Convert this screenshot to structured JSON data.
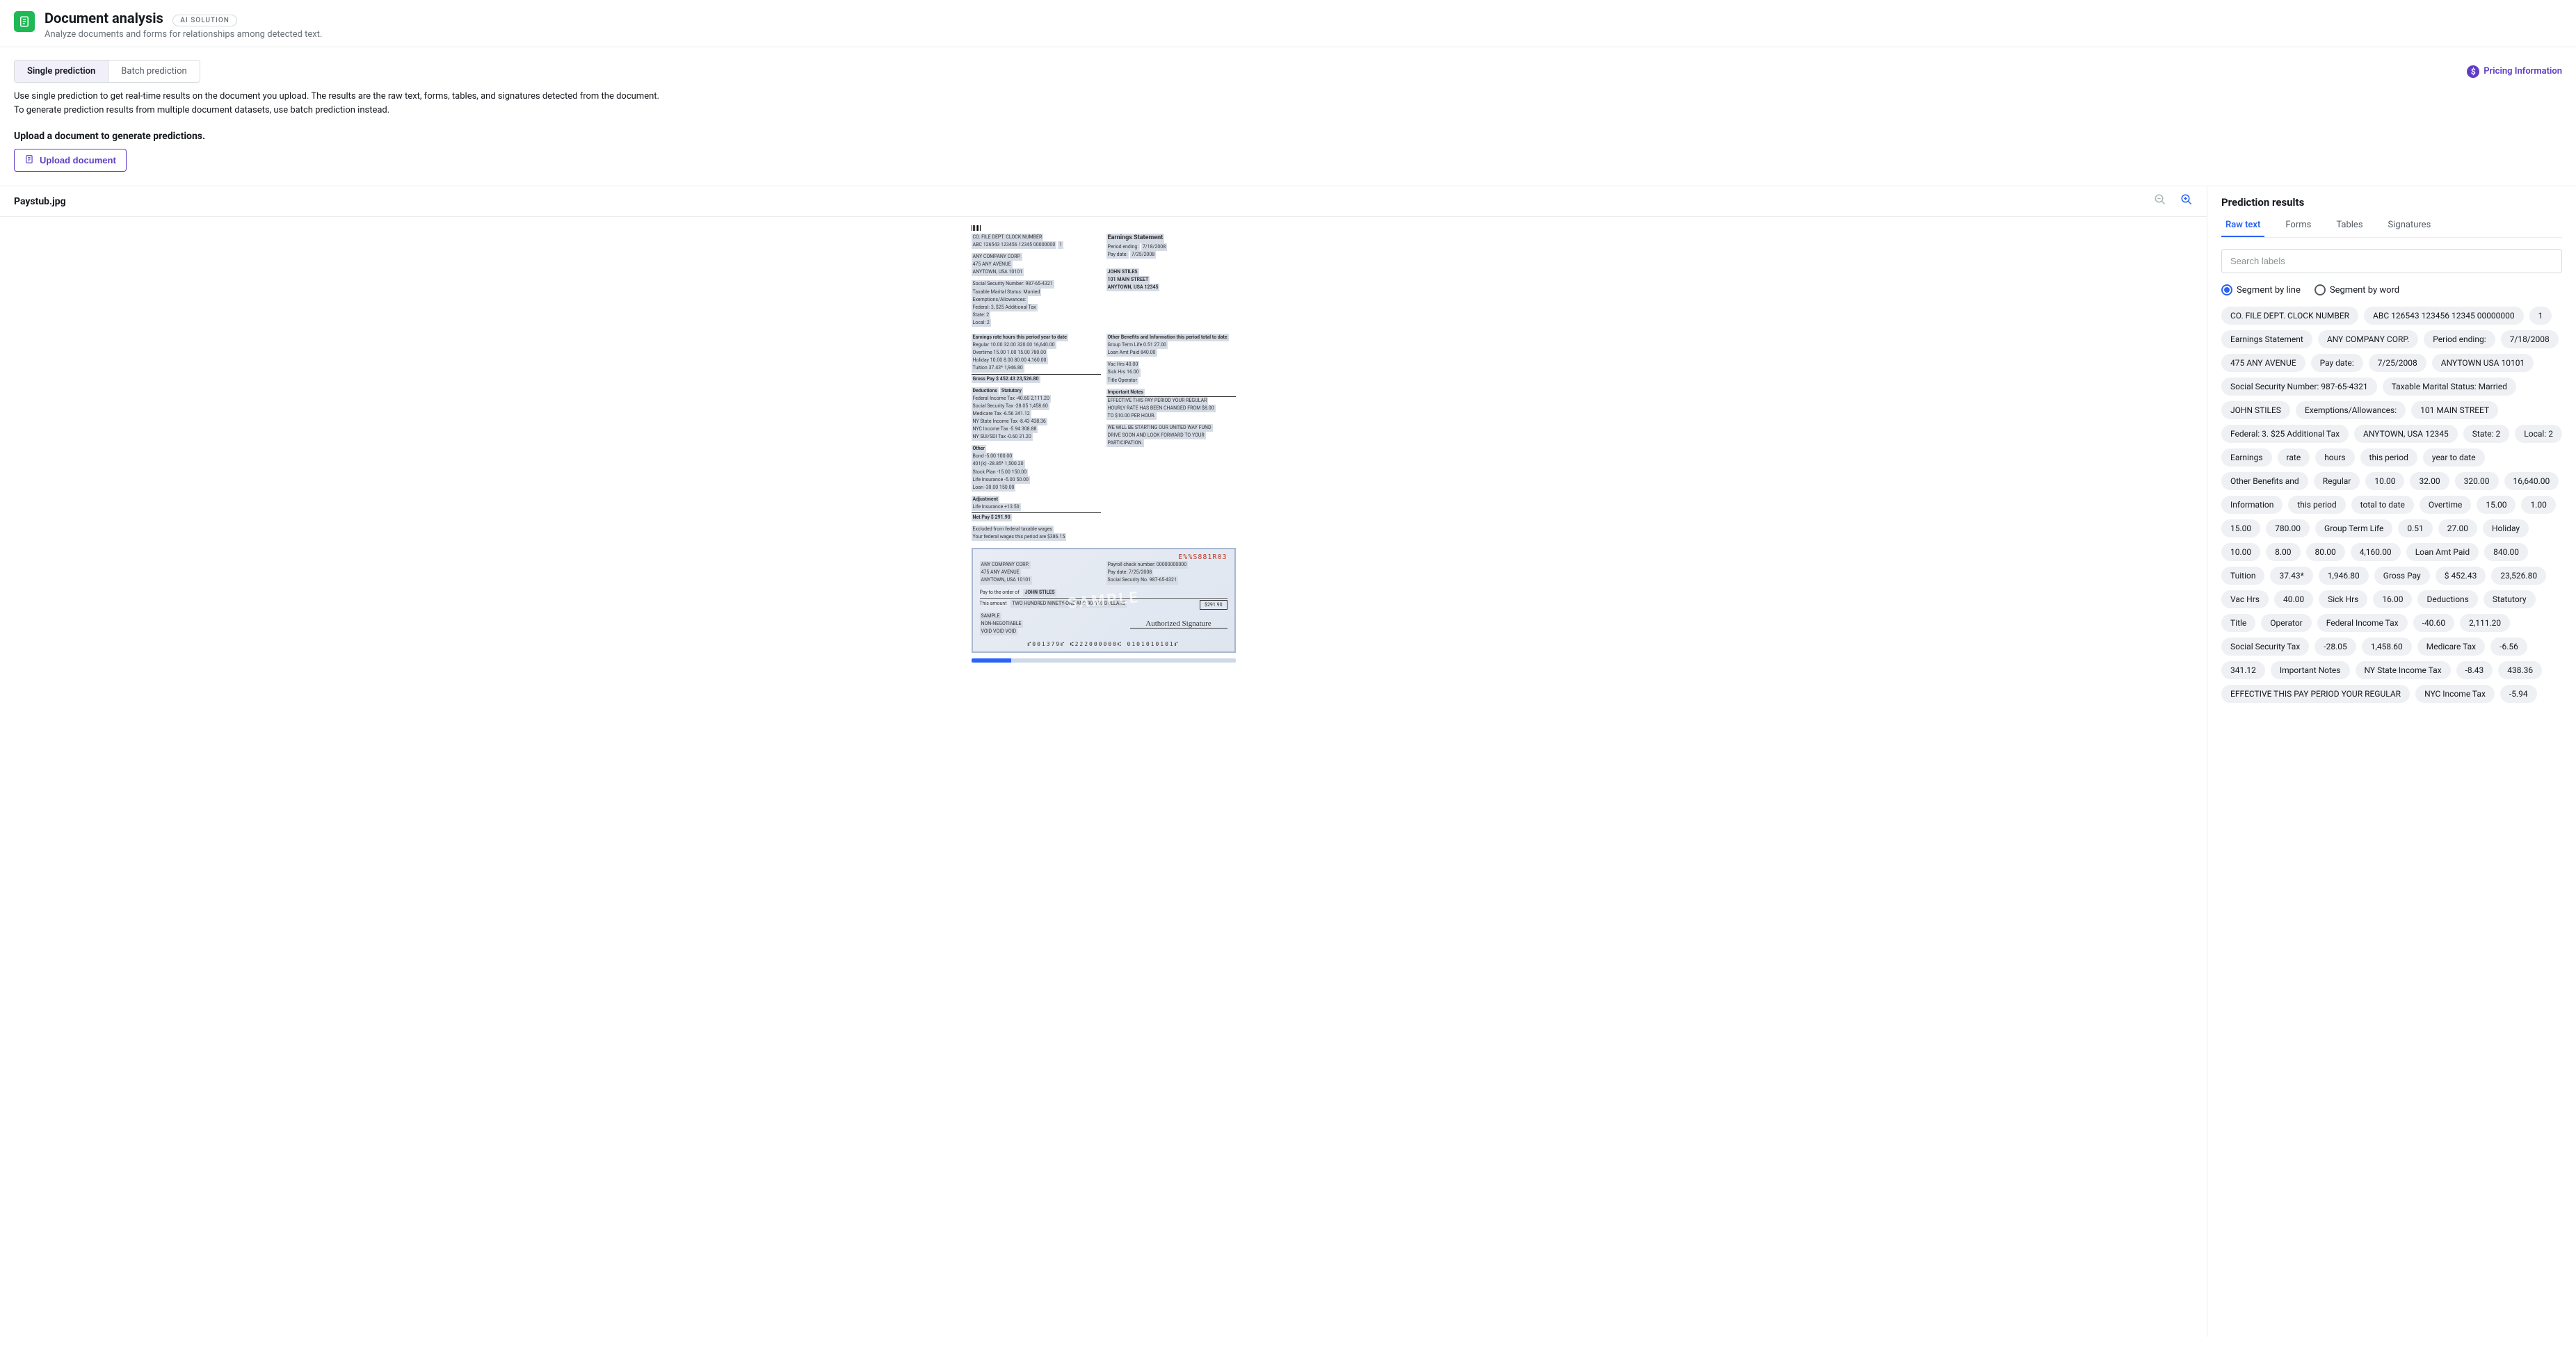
{
  "header": {
    "title": "Document analysis",
    "badge": "AI SOLUTION",
    "subtitle": "Analyze documents and forms for relationships among detected text."
  },
  "modeTabs": {
    "single": "Single prediction",
    "batch": "Batch prediction"
  },
  "pricing": "Pricing Information",
  "description": {
    "line1": "Use single prediction to get real-time results on the document you upload. The results are the raw text, forms, tables, and signatures detected from the document.",
    "line2": "To generate prediction results from multiple document datasets, use batch prediction instead."
  },
  "upload": {
    "heading": "Upload a document to generate predictions.",
    "button": "Upload document"
  },
  "document": {
    "filename": "Paystub.jpg"
  },
  "results": {
    "title": "Prediction results",
    "tabs": [
      "Raw text",
      "Forms",
      "Tables",
      "Signatures"
    ],
    "activeTab": 0,
    "searchPlaceholder": "Search labels",
    "segment": {
      "line": "Segment by line",
      "word": "Segment by word",
      "selected": "line"
    },
    "chips": [
      "CO. FILE DEPT. CLOCK NUMBER",
      "ABC 126543 123456 12345 00000000",
      "1",
      "Earnings Statement",
      "ANY COMPANY CORP.",
      "Period ending:",
      "7/18/2008",
      "475 ANY AVENUE",
      "Pay date:",
      "7/25/2008",
      "ANYTOWN USA 10101",
      "Social Security Number: 987-65-4321",
      "Taxable Marital Status: Married",
      "JOHN STILES",
      "Exemptions/Allowances:",
      "101 MAIN STREET",
      "Federal: 3. $25 Additional Tax",
      "ANYTOWN, USA 12345",
      "State: 2",
      "Local: 2",
      "Earnings",
      "rate",
      "hours",
      "this period",
      "year to date",
      "Other Benefits and",
      "Regular",
      "10.00",
      "32.00",
      "320.00",
      "16,640.00",
      "Information",
      "this period",
      "total to date",
      "Overtime",
      "15.00",
      "1.00",
      "15.00",
      "780.00",
      "Group Term Life",
      "0.51",
      "27.00",
      "Holiday",
      "10.00",
      "8.00",
      "80.00",
      "4,160.00",
      "Loan Amt Paid",
      "840.00",
      "Tuition",
      "37.43*",
      "1,946.80",
      "Gross Pay",
      "$ 452.43",
      "23,526.80",
      "Vac Hrs",
      "40.00",
      "Sick Hrs",
      "16.00",
      "Deductions",
      "Statutory",
      "Title",
      "Operator",
      "Federal Income Tax",
      "-40.60",
      "2,111.20",
      "Social Security Tax",
      "-28.05",
      "1,458.60",
      "Medicare Tax",
      "-6.56",
      "341.12",
      "Important Notes",
      "NY State Income Tax",
      "-8.43",
      "438.36",
      "EFFECTIVE THIS PAY PERIOD YOUR REGULAR",
      "NYC Income Tax",
      "-5.94"
    ]
  },
  "preview": {
    "coFile": "CO.  FILE   DEPT.  CLOCK  NUMBER",
    "coFileVal": "ABC 126543 123456 12345 00000000",
    "one": "1",
    "company": "ANY COMPANY CORP.",
    "addr1": "475 ANY AVENUE",
    "addr2": "ANYTOWN, USA 10101",
    "ssn": "Social Security Number: 987-65-4321",
    "marital": "Taxable Marital Status: Married",
    "exempt": "Exemptions/Allowances:",
    "fed": "Federal: 3, $25 Additional Tax",
    "state": "State: 2",
    "local": "Local: 2",
    "earnTitle": "Earnings Statement",
    "periodEnd": "Period ending:",
    "periodEndVal": "7/18/2008",
    "payDate": "Pay date:",
    "payDateVal": "7/25/2008",
    "recipient": "JOHN STILES",
    "raddr1": "101 MAIN STREET",
    "raddr2": "ANYTOWN, USA 12345",
    "earnHdr": "Earnings    rate    hours    this period   year to date",
    "regular": "Regular   10.00   32.00   320.00   16,640.00",
    "overtime": "Overtime  15.00   1.00    15.00    780.00",
    "holiday": "Holiday   10.00   8.00    80.00    4,160.00",
    "tuition": "Tuition                   37.43*   1,946.80",
    "gross": "Gross Pay          $ 452.43   23,526.80",
    "deductions": "Deductions",
    "statutory": "Statutory",
    "fedTax": "Federal Income Tax   -40.60   2,111.20",
    "ssTax": "Social Security Tax  -28.05   1,458.60",
    "medTax": "Medicare Tax         -6.56    341.12",
    "nysTax": "NY State Income Tax  -8.43    438.36",
    "nycTax": "NYC Income Tax       -5.94    308.88",
    "suisdi": "NY SUI/SDI Tax       -0.60    31.20",
    "other": "Other",
    "bond": "Bond       -5.00   100.00",
    "k401": "401(k)     -28.85* 1,500.20",
    "stockPlan": "Stock Plan -15.00  150.00",
    "lifeIns": "Life Insurance -5.00 50.00",
    "loan": "Loan       -30.00  150.00",
    "adj": "Adjustment",
    "lifeIns2": "Life Insurance  +13.50",
    "netpay": "Net Pay            $ 291.90",
    "excluded": "Excluded from federal taxable wages",
    "fedWages": "Your federal wages this period are $386.15",
    "otherBen": "Other Benefits and Information   this period   total to date",
    "gtl": "Group Term Life   0.51   27.00",
    "loanAmt": "Loan Amt Paid            840.00",
    "vac": "Vac Hrs          40.00",
    "sick": "Sick Hrs         16.00",
    "titleOp": "Title    Operator",
    "impNotes": "Important Notes",
    "note1": "EFFECTIVE THIS PAY PERIOD YOUR REGULAR",
    "note2": "HOURLY RATE HAS BEEN CHANGED FROM $8.00",
    "note3": "TO $10.00 PER HOUR.",
    "note4": "WE WILL BE STARTING OUR UNITED WAY FUND",
    "note5": "DRIVE SOON AND LOOK FORWARD TO YOUR",
    "note6": "PARTICIPATION.",
    "checkCompany": "ANY COMPANY CORP.",
    "checkAddr1": "475 ANY AVENUE",
    "checkAddr2": "ANYTOWN, USA 10101",
    "checkNum": "E%%S881R03",
    "payrollCheck": "Payroll check number:  00000000000",
    "checkPayDate": "Pay date:   7/25/2008",
    "checkSSN": "Social Security No.  987-65-4321",
    "payTo": "Pay to the order of",
    "payee": "JOHN STILES",
    "thisAmount": "This amount",
    "amountWords": "TWO HUNDRED NINETY-ONE AND 90/100 DOLLARS",
    "amountBox": "$291.90",
    "sampleL1": "SAMPLE",
    "sampleL2": "NON-NEGOTIABLE",
    "sampleL3": "VOID VOID VOID",
    "sig": "Authorized Signature",
    "micr": "⑈001379⑈ ⑆222000000⑆ 0101010101⑈",
    "watermark": "SAMPLE"
  }
}
